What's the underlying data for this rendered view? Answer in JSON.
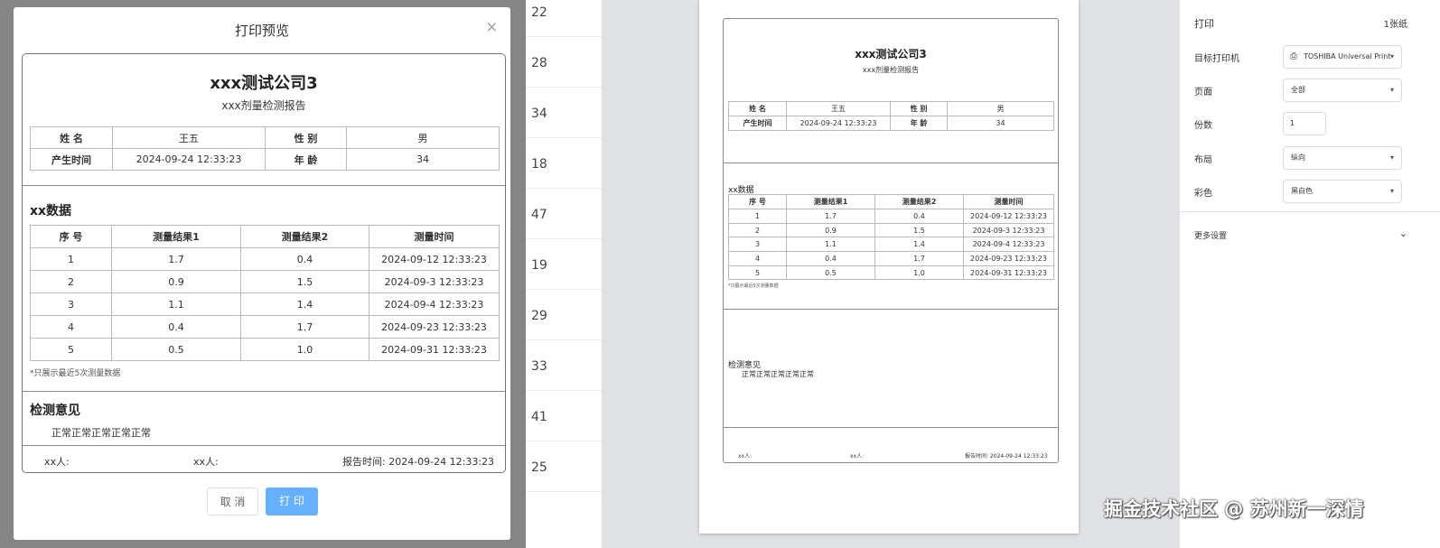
{
  "dialog": {
    "title": "打印预览",
    "close": "×",
    "cancel": "取 消",
    "print": "打 印"
  },
  "report": {
    "company": "xxx测试公司3",
    "subtitle": "xxx剂量检测报告",
    "info": {
      "name_label": "姓 名",
      "name": "王五",
      "gender_label": "性 别",
      "gender": "男",
      "time_label": "产生时间",
      "time": "2024-09-24 12:33:23",
      "age_label": "年 龄",
      "age": "34"
    },
    "section_data": "xx数据",
    "columns": [
      "序 号",
      "测量结果1",
      "测量结果2",
      "测量时间"
    ],
    "rows": [
      [
        "1",
        "1.7",
        "0.4",
        "2024-09-12 12:33:23"
      ],
      [
        "2",
        "0.9",
        "1.5",
        "2024-09-3 12:33:23"
      ],
      [
        "3",
        "1.1",
        "1.4",
        "2024-09-4 12:33:23"
      ],
      [
        "4",
        "0.4",
        "1.7",
        "2024-09-23 12:33:23"
      ],
      [
        "5",
        "0.5",
        "1.0",
        "2024-09-31 12:33:23"
      ]
    ],
    "note": "*只展示最近5次测量数据",
    "section_opinion": "检测意见",
    "opinion": "正常正常正常正常正常",
    "footer": {
      "person1": "xx人:",
      "person2": "xx人:",
      "report_time": "报告时间: 2024-09-24 12:33:23"
    }
  },
  "side_numbers": [
    "22",
    "28",
    "34",
    "18",
    "47",
    "19",
    "29",
    "33",
    "41",
    "25"
  ],
  "print_settings": {
    "title": "打印",
    "sheets": "1张纸",
    "printer_label": "目标打印机",
    "printer": "TOSHIBA Universal Print",
    "pages_label": "页面",
    "pages": "全部",
    "copies_label": "份数",
    "copies": "1",
    "layout_label": "布局",
    "layout": "纵向",
    "color_label": "彩色",
    "color": "黑白色",
    "more": "更多设置"
  },
  "watermark": "掘金技术社区 @ 苏州新一深情"
}
